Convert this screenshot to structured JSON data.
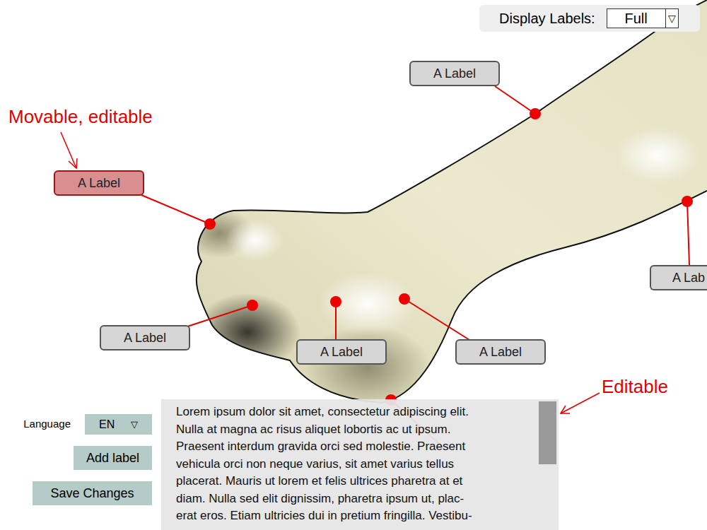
{
  "display_labels": {
    "label": "Display Labels:",
    "value": "Full",
    "arrow": "▽"
  },
  "labels": [
    {
      "text": "A Label",
      "selected": true
    },
    {
      "text": "A Label",
      "selected": false
    },
    {
      "text": "A Label",
      "selected": false
    },
    {
      "text": "A Label",
      "selected": false
    },
    {
      "text": "A Label",
      "selected": false
    },
    {
      "text": "A Lab",
      "selected": false
    }
  ],
  "annotations": [
    {
      "text": "Movable, editable"
    },
    {
      "text": "Editable"
    }
  ],
  "language": {
    "label": "Language",
    "value": "EN",
    "arrow": "▽"
  },
  "buttons": [
    "Add label",
    "Save Changes"
  ],
  "editor": {
    "lines": [
      "Lorem ipsum dolor sit amet, consectetur adipiscing elit.",
      "Nulla at magna ac risus aliquet lobortis ac ut ipsum.",
      "Praesent interdum gravida orci sed molestie. Praesent",
      "vehicula orci non neque varius, sit amet varius tellus",
      "placerat. Mauris ut lorem et felis ultrices pharetra at et",
      "diam. Nulla sed elit dignissim, pharetra ipsum ut, plac-",
      "erat eros. Etiam ultricies dui in pretium fringilla. Vestibu-"
    ]
  }
}
